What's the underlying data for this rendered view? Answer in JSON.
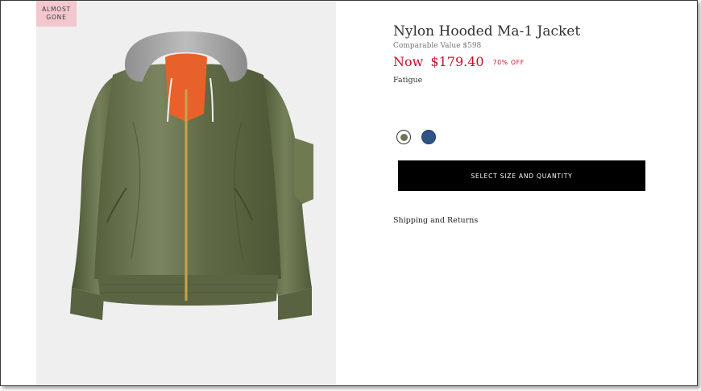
{
  "product": {
    "badge_line1": "ALMOST",
    "badge_line2": "GONE",
    "title": "Nylon Hooded Ma-1 Jacket",
    "comparable_value": "Comparable Value $598",
    "price_prefix": "Now",
    "price": "$179.40",
    "discount": "70% OFF",
    "color_name": "Fatigue",
    "image_icon": "jacket-image"
  },
  "swatches": [
    {
      "name": "fatigue",
      "color": "#6b7454",
      "selected": true
    },
    {
      "name": "navy",
      "color": "#2f5486",
      "selected": false
    }
  ],
  "actions": {
    "select_size": "SELECT SIZE AND QUANTITY",
    "shipping_link": "Shipping and Returns"
  },
  "colors": {
    "accent": "#c8102e",
    "badge_bg": "#f3c7ce",
    "button_bg": "#000000",
    "image_bg": "#efefef"
  }
}
